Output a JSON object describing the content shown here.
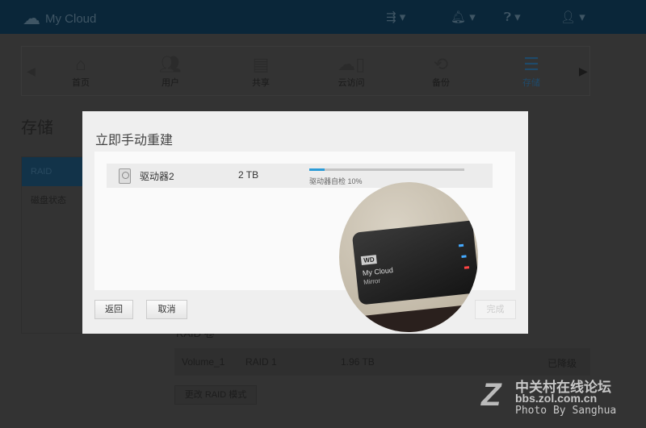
{
  "header": {
    "app_title": "My Cloud",
    "icons": [
      "usb-icon",
      "bell-icon",
      "help-icon",
      "user-icon"
    ]
  },
  "nav": {
    "items": [
      {
        "label": "首页",
        "icon": "home-icon"
      },
      {
        "label": "用户",
        "icon": "users-icon"
      },
      {
        "label": "共享",
        "icon": "folder-icon"
      },
      {
        "label": "云访问",
        "icon": "cloud-access-icon"
      },
      {
        "label": "备份",
        "icon": "backup-icon"
      },
      {
        "label": "存储",
        "icon": "storage-icon",
        "active": true
      }
    ]
  },
  "page": {
    "title": "存储",
    "sidebar": [
      "RAID",
      "磁盘状态"
    ],
    "raid_label": "RAID 卷",
    "volume": {
      "name": "Volume_1",
      "type": "RAID 1",
      "size": "1.96 TB",
      "status": "已降级"
    },
    "change_button": "更改 RAID 模式"
  },
  "dialog": {
    "title": "立即手动重建",
    "drive": {
      "name": "驱动器2",
      "size": "2 TB",
      "progress": 10,
      "status": "驱动器自检 10%"
    },
    "back": "返回",
    "cancel": "取消",
    "finish": "完成"
  },
  "photo": {
    "brand": "WD",
    "line1": "My Cloud",
    "line2": "Mirror"
  },
  "watermark": {
    "site_cn": "中关村在线论坛",
    "url": "bbs.zol.com.cn",
    "credit": "Photo By Sanghua"
  },
  "colors": {
    "accent": "#2b9bd7",
    "header": "#0a2639"
  }
}
